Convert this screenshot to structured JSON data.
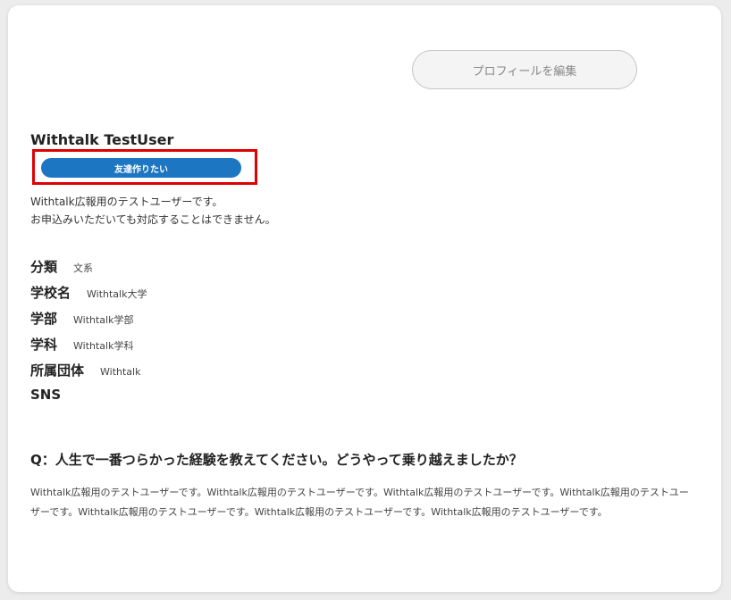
{
  "profile": {
    "edit_button_label": "プロフィールを編集",
    "name": "Withtalk TestUser",
    "tag_label": "友達作りたい",
    "intro_lines": [
      "Withtalk広報用のテストユーザーです。",
      "お申込みいただいても対応することはできません。"
    ]
  },
  "info": [
    {
      "label": "分類",
      "value": "文系"
    },
    {
      "label": "学校名",
      "value": "Withtalk大学"
    },
    {
      "label": "学部",
      "value": "Withtalk学部"
    },
    {
      "label": "学科",
      "value": "Withtalk学科"
    },
    {
      "label": "所属団体",
      "value": "Withtalk"
    },
    {
      "label": "SNS",
      "value": ""
    }
  ],
  "qa": {
    "question": "Q：人生で一番つらかった経験を教えてください。どうやって乗り越えましたか？",
    "answer": "Withtalk広報用のテストユーザーです。Withtalk広報用のテストユーザーです。Withtalk広報用のテストユーザーです。Withtalk広報用のテストユーザーです。Withtalk広報用のテストユーザーです。Withtalk広報用のテストユーザーです。Withtalk広報用のテストユーザーです。"
  },
  "colors": {
    "accent": "#1d76c2",
    "highlight": "#e00000"
  }
}
